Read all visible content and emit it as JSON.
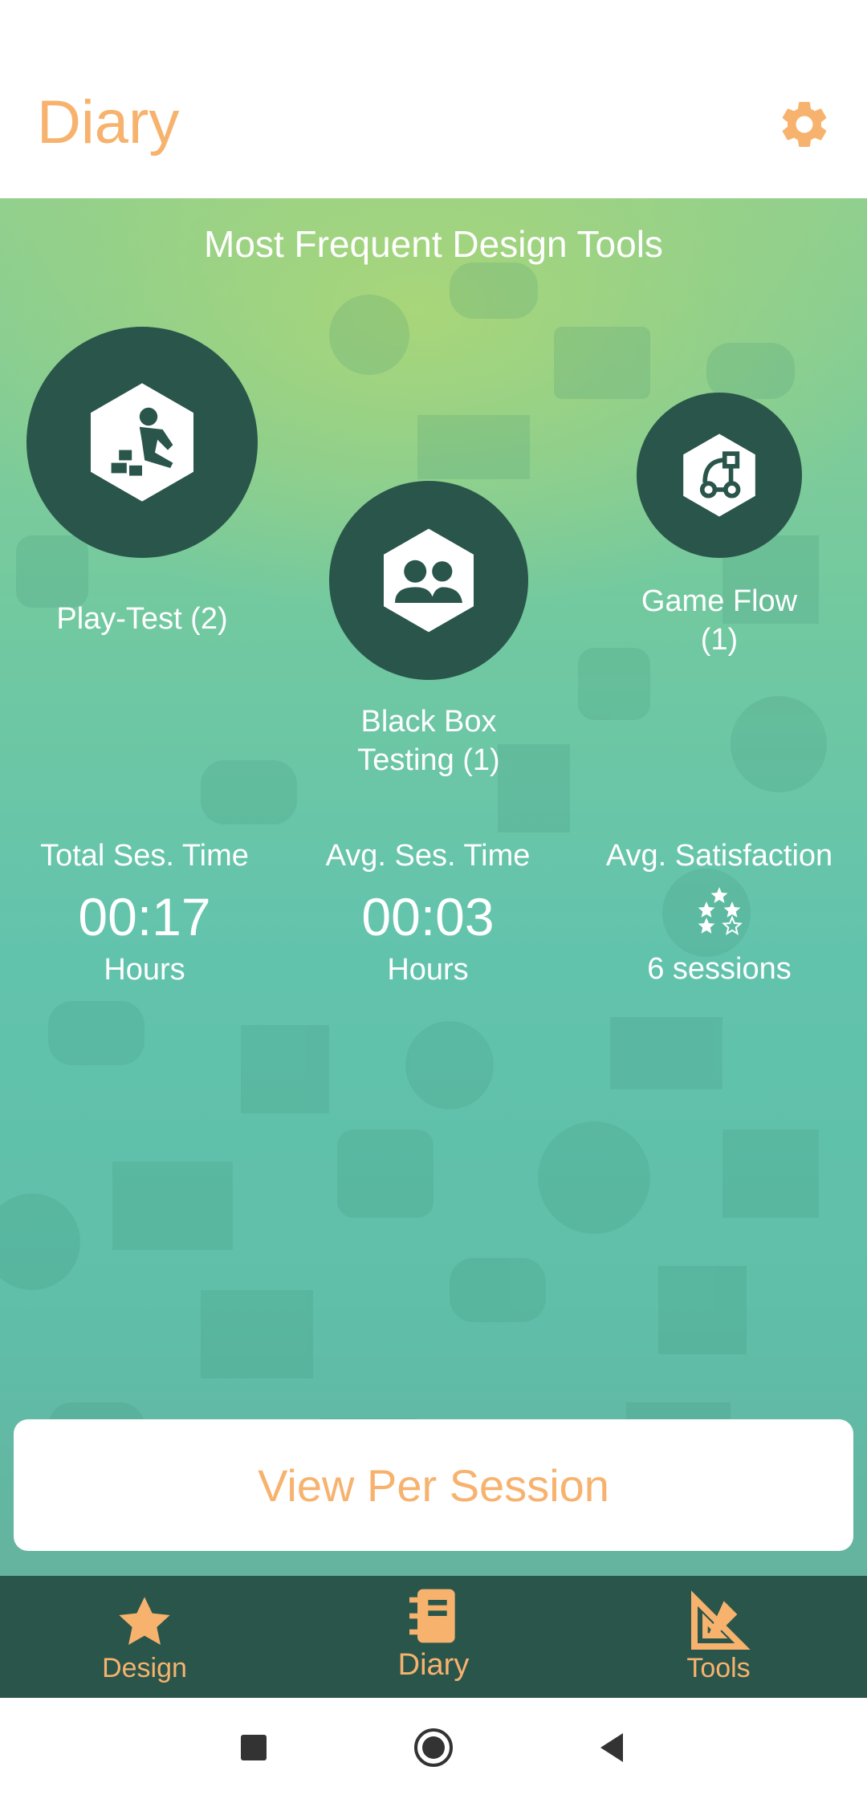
{
  "header": {
    "title": "Diary",
    "settings_icon": "gear-icon"
  },
  "colors": {
    "accent": "#f7b26e",
    "dark_green": "#2a554b",
    "background_top": "#a8d37a",
    "background_bottom": "#5fbfa9"
  },
  "main": {
    "section_title": "Most Frequent Design Tools",
    "tools": [
      {
        "label": "Play-Test (2)",
        "icon": "play-test-icon"
      },
      {
        "label": "Black Box Testing (1)",
        "icon": "group-icon"
      },
      {
        "label": "Game Flow (1)",
        "icon": "flow-icon"
      }
    ],
    "stats": {
      "total_time": {
        "label": "Total Ses. Time",
        "value": "00:17",
        "unit": "Hours"
      },
      "avg_time": {
        "label": "Avg. Ses. Time",
        "value": "00:03",
        "unit": "Hours"
      },
      "satisfaction": {
        "label": "Avg. Satisfaction",
        "sessions": "6 sessions",
        "stars_filled": 4,
        "stars_total": 5
      }
    },
    "view_button": "View Per Session"
  },
  "bottom_nav": [
    {
      "label": "Design",
      "icon": "star-icon"
    },
    {
      "label": "Diary",
      "icon": "notebook-icon"
    },
    {
      "label": "Tools",
      "icon": "set-square-icon"
    }
  ],
  "system_nav": [
    "recents-icon",
    "home-icon",
    "back-icon"
  ]
}
